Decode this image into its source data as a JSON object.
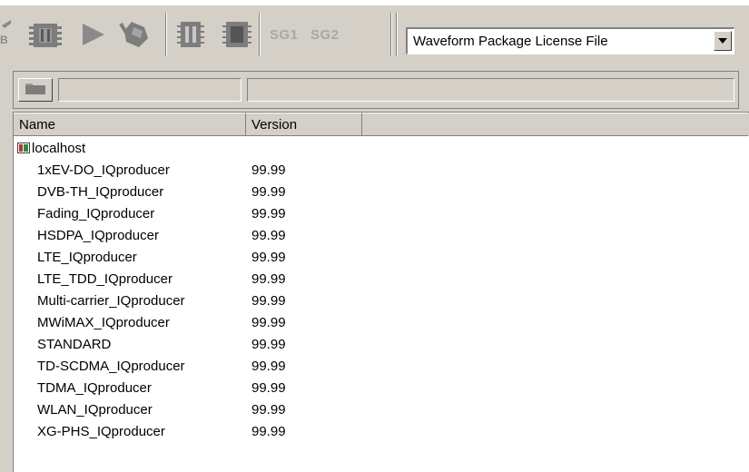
{
  "toolbar": {
    "buttons": [
      {
        "icon": "partial-tool-icon"
      },
      {
        "icon": "chip-icon"
      },
      {
        "icon": "play-icon"
      },
      {
        "icon": "pen-tool-icon"
      },
      {
        "icon": "pause-icon"
      },
      {
        "icon": "stop-icon"
      }
    ],
    "sg1_label": "SG1",
    "sg2_label": "SG2",
    "file_type_select": {
      "value": "Waveform Package License File"
    }
  },
  "pathbar": {
    "folder_icon": "folder-icon"
  },
  "list": {
    "columns": {
      "name": "Name",
      "version": "Version"
    },
    "host": {
      "label": "localhost",
      "icon": "host-icon"
    },
    "items": [
      {
        "name": "1xEV-DO_IQproducer",
        "version": "99.99"
      },
      {
        "name": "DVB-TH_IQproducer",
        "version": "99.99"
      },
      {
        "name": "Fading_IQproducer",
        "version": "99.99"
      },
      {
        "name": "HSDPA_IQproducer",
        "version": "99.99"
      },
      {
        "name": "LTE_IQproducer",
        "version": "99.99"
      },
      {
        "name": "LTE_TDD_IQproducer",
        "version": "99.99"
      },
      {
        "name": "Multi-carrier_IQproducer",
        "version": "99.99"
      },
      {
        "name": "MWiMAX_IQproducer",
        "version": "99.99"
      },
      {
        "name": "STANDARD",
        "version": "99.99"
      },
      {
        "name": "TD-SCDMA_IQproducer",
        "version": "99.99"
      },
      {
        "name": "TDMA_IQproducer",
        "version": "99.99"
      },
      {
        "name": "WLAN_IQproducer",
        "version": "99.99"
      },
      {
        "name": "XG-PHS_IQproducer",
        "version": "99.99"
      }
    ]
  },
  "colors": {
    "window_bg": "#d4d0c8",
    "list_bg": "#ffffff",
    "icon_gray": "#8a8a8a",
    "host_icon_red": "#c03030",
    "host_icon_green": "#2e8b3e"
  }
}
